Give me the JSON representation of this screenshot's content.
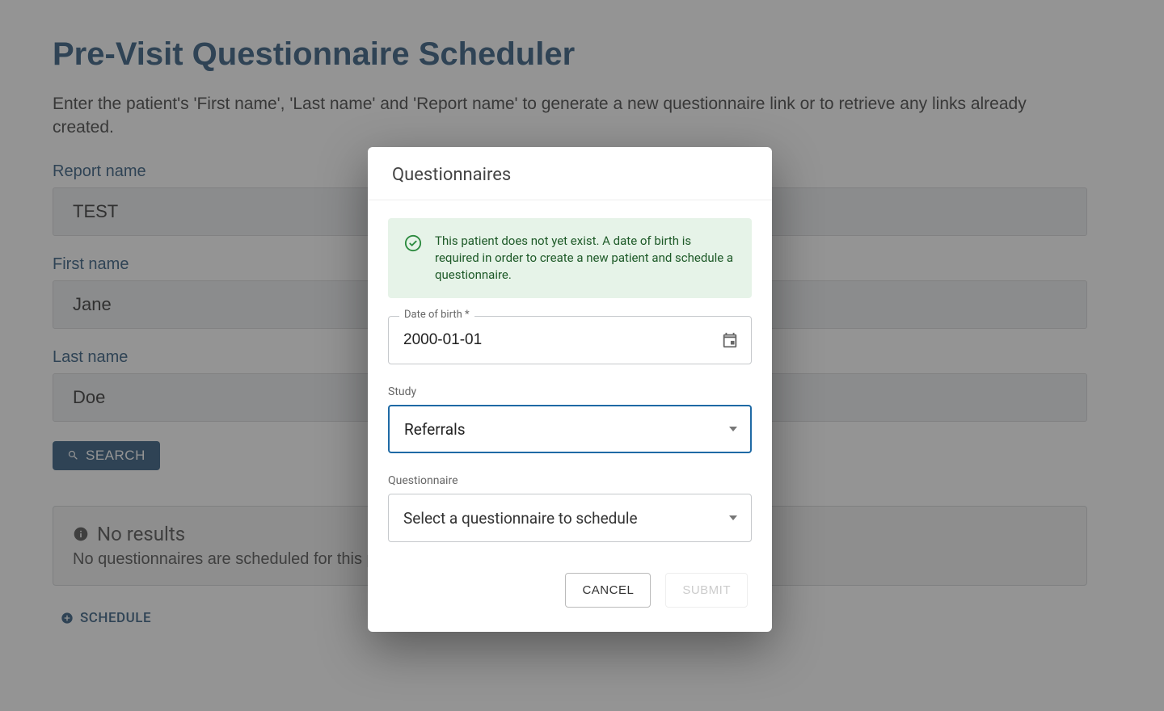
{
  "page": {
    "title": "Pre-Visit Questionnaire Scheduler",
    "subtitle": "Enter the patient's 'First name', 'Last name' and 'Report name' to generate a new questionnaire link or to retrieve any links already created."
  },
  "form": {
    "report_name_label": "Report name",
    "report_name_value": "TEST",
    "first_name_label": "First name",
    "first_name_value": "Jane",
    "last_name_label": "Last name",
    "last_name_value": "Doe",
    "search_label": "SEARCH"
  },
  "results": {
    "heading": "No results",
    "text": "No questionnaires are scheduled for this patient."
  },
  "schedule_link_label": "SCHEDULE",
  "modal": {
    "title": "Questionnaires",
    "alert_text": "This patient does not yet exist. A date of birth is required in order to create a new patient and schedule a questionnaire.",
    "dob_label": "Date of birth *",
    "dob_value": "2000-01-01",
    "study_label": "Study",
    "study_value": "Referrals",
    "questionnaire_label": "Questionnaire",
    "questionnaire_placeholder": "Select a questionnaire to schedule",
    "cancel_label": "CANCEL",
    "submit_label": "SUBMIT"
  },
  "icons": {
    "search": "search-icon",
    "info": "info-icon",
    "plus_circle": "plus-circle-icon",
    "check_circle": "check-circle-icon",
    "calendar": "calendar-icon",
    "chevron_down": "chevron-down-icon"
  }
}
